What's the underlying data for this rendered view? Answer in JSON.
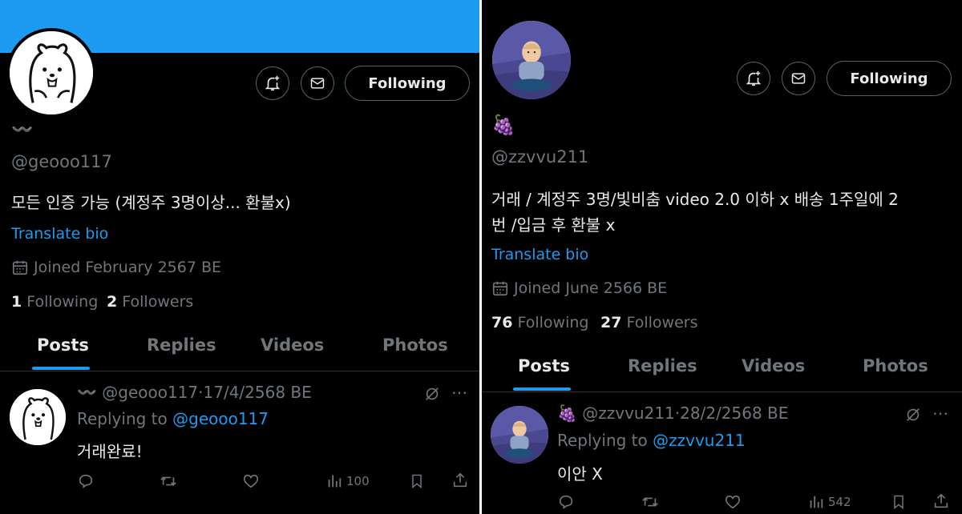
{
  "left": {
    "name": "〰️",
    "handle": "@geooo117",
    "bio": "모든 인증 가능 (계정주 3명이상... 환불x)",
    "translate": "Translate bio",
    "joined": "Joined February 2567 BE",
    "following_count": "1",
    "following_label": "Following",
    "followers_count": "2",
    "followers_label": "Followers",
    "follow_button": "Following",
    "tabs": [
      "Posts",
      "Replies",
      "Videos",
      "Photos"
    ],
    "post": {
      "name": "〰️",
      "handle": "@geooo117",
      "date": "·17/4/2568 BE",
      "replying_prefix": "Replying to",
      "replying_to": "@geooo117",
      "text": "거래완료!",
      "views": "100"
    }
  },
  "right": {
    "name": "🍇",
    "handle": "@zzvvu211",
    "bio_line1": "거래 / 계정주 3명/빛비춤 video 2.0 이하 x 배송 1주일에 2",
    "bio_line2": "번 /입금 후 환불 x",
    "translate": "Translate bio",
    "joined": "Joined June 2566 BE",
    "following_count": "76",
    "following_label": "Following",
    "followers_count": "27",
    "followers_label": "Followers",
    "follow_button": "Following",
    "tabs": [
      "Posts",
      "Replies",
      "Videos",
      "Photos"
    ],
    "post": {
      "name": "🍇",
      "handle": "@zzvvu211",
      "date": "·28/2/2568 BE",
      "replying_prefix": "Replying to",
      "replying_to": "@zzvvu211",
      "text": "이안 X",
      "views": "542"
    }
  },
  "colors": {
    "accent": "#1d9bf0",
    "muted": "#71767b",
    "text": "#e7e9ea",
    "background": "#000000"
  },
  "icons": [
    "bell-plus-icon",
    "mail-icon",
    "calendar-icon",
    "mute-icon",
    "more-icon",
    "reply-icon",
    "retweet-icon",
    "like-icon",
    "views-icon",
    "bookmark-icon",
    "share-icon"
  ]
}
